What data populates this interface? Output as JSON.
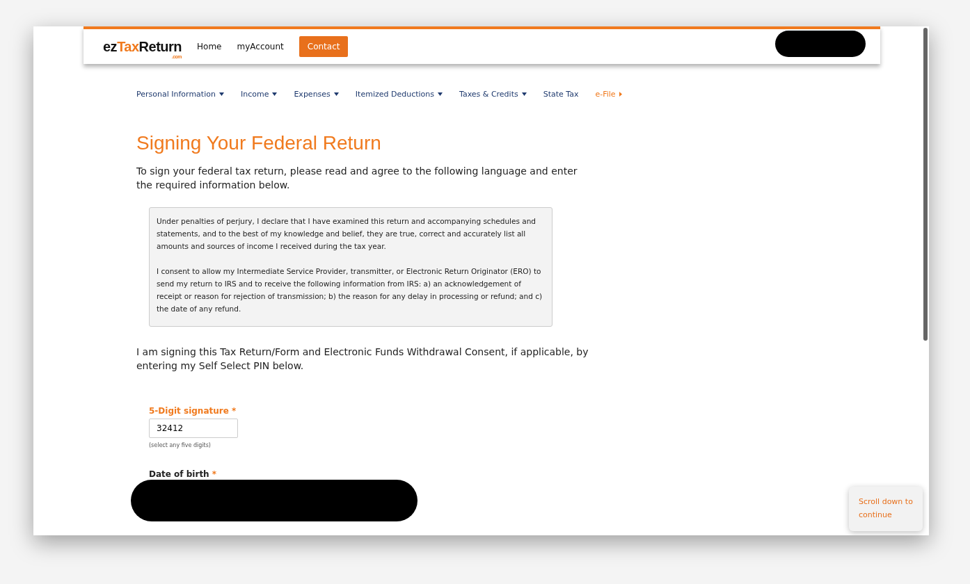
{
  "header": {
    "logo": {
      "prefix": "ez",
      "highlight": "Tax",
      "suffix": "Return",
      "domain": ".com"
    },
    "links": [
      {
        "label": "Home",
        "kind": "link"
      },
      {
        "label": "myAccount",
        "kind": "link"
      },
      {
        "label": "Contact",
        "kind": "button"
      }
    ]
  },
  "nav": [
    {
      "label": "Personal Information",
      "has_menu": true,
      "selected": false
    },
    {
      "label": "Income",
      "has_menu": true,
      "selected": false
    },
    {
      "label": "Expenses",
      "has_menu": true,
      "selected": false
    },
    {
      "label": "Itemized Deductions",
      "has_menu": true,
      "selected": false
    },
    {
      "label": "Taxes & Credits",
      "has_menu": true,
      "selected": false
    },
    {
      "label": "State Tax",
      "has_menu": false,
      "selected": false
    },
    {
      "label": "e-File",
      "has_menu": false,
      "selected": true
    }
  ],
  "page": {
    "title": "Signing Your Federal Return",
    "intro": "To sign your federal tax return, please read and agree to the following language and enter the required information below.",
    "declaration": [
      "Under penalties of perjury, I declare that I have examined this return and accompanying schedules and statements, and to the best of my knowledge and belief, they are true, correct and accurately list all amounts and sources of income I received during the tax year.",
      "I consent to allow my Intermediate Service Provider, transmitter, or Electronic Return Originator (ERO) to send my return to IRS and to receive the following information from IRS: a) an acknowledgement of receipt or reason for rejection of transmission; b) the reason for any delay in processing or refund; and c) the date of any refund."
    ],
    "signing_text": "I am signing this Tax Return/Form and Electronic Funds Withdrawal Consent, if applicable, by entering my Self Select PIN below.",
    "signature": {
      "label": "5-Digit signature",
      "required_mark": "*",
      "value": "32412",
      "hint": "(select any five digits)"
    },
    "birth_date": {
      "label": "Date of birth",
      "required_mark": "*"
    }
  },
  "scroll_hint": "Scroll down to continue"
}
